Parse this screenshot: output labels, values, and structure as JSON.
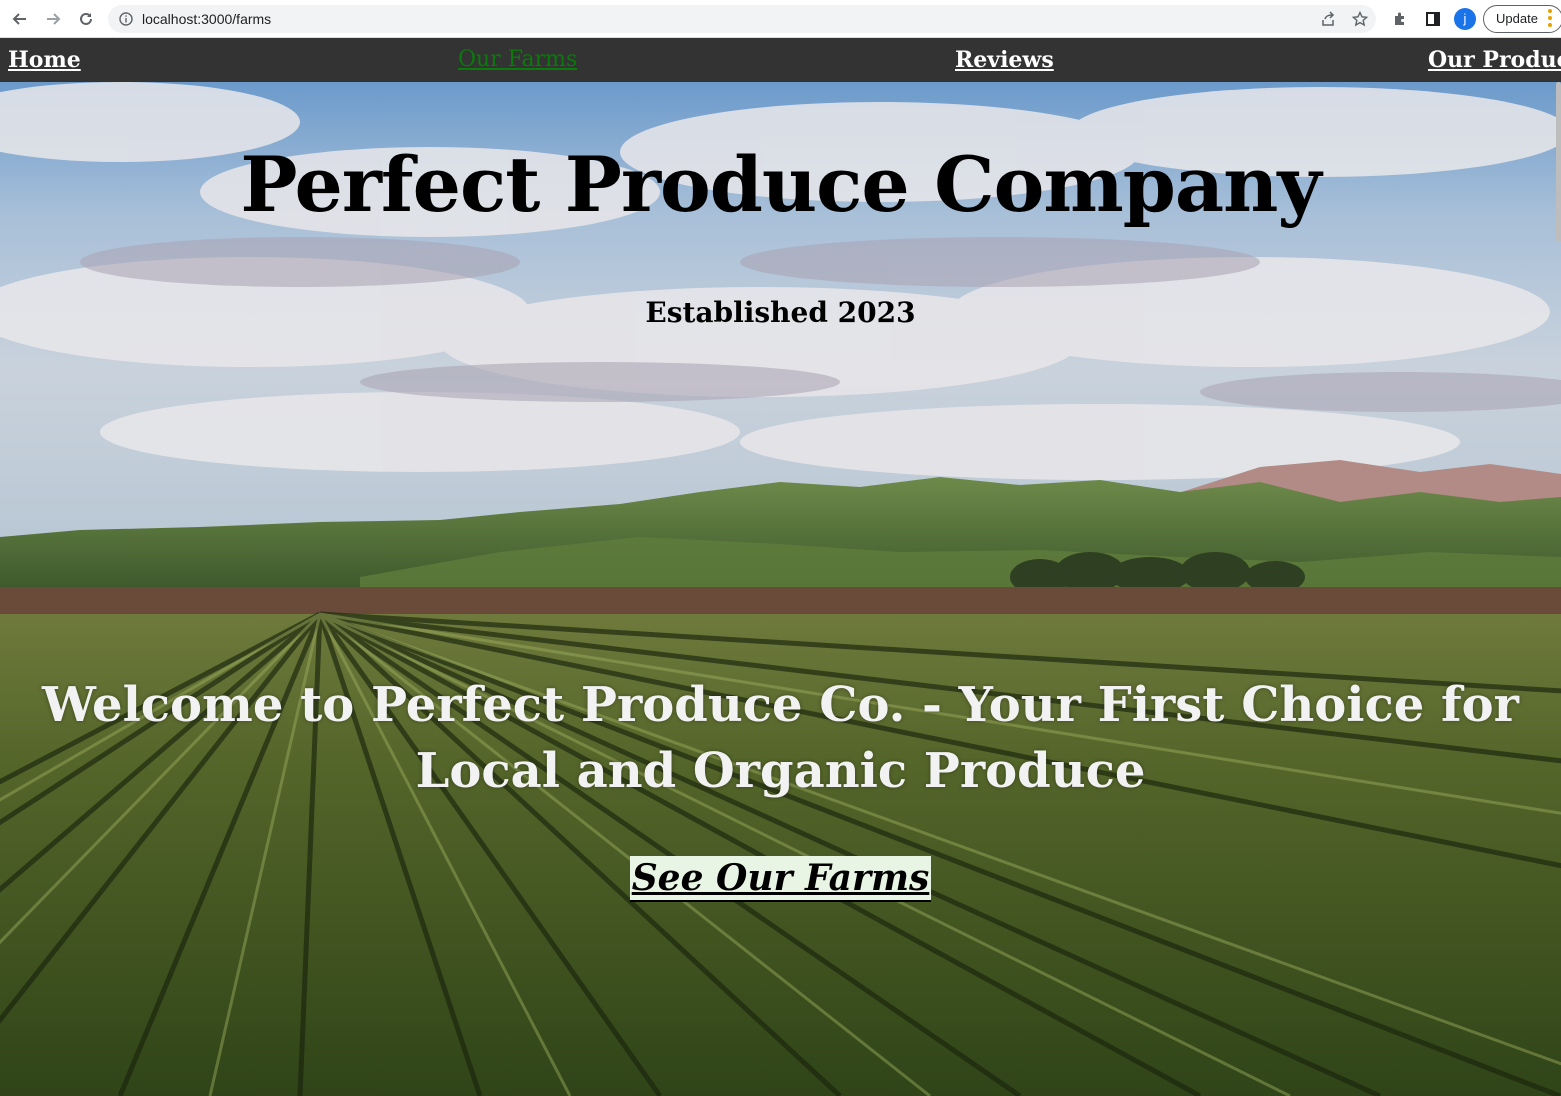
{
  "browser": {
    "url": "localhost:3000/farms",
    "avatar_letter": "j",
    "update_label": "Update",
    "icons": [
      "back-arrow-icon",
      "forward-arrow-icon",
      "reload-icon",
      "info-icon",
      "share-icon",
      "star-icon",
      "puzzle-icon",
      "side-panel-icon",
      "more-vert-icon"
    ]
  },
  "nav": {
    "items": [
      {
        "label": "Home",
        "active": false
      },
      {
        "label": "Our Farms",
        "active": true
      },
      {
        "label": "Reviews",
        "active": false
      },
      {
        "label": "Our Products",
        "active": false
      }
    ]
  },
  "hero": {
    "title": "Perfect Produce Company",
    "subtitle": "Established 2023",
    "welcome": "Welcome to Perfect Produce Co. - Your First Choice for Local and Organic Produce",
    "cta_label": "See Our Farms"
  },
  "colors": {
    "nav_bg": "#333333",
    "nav_active": "#0a7a0a",
    "cta_bg": "#e8f5e4"
  }
}
